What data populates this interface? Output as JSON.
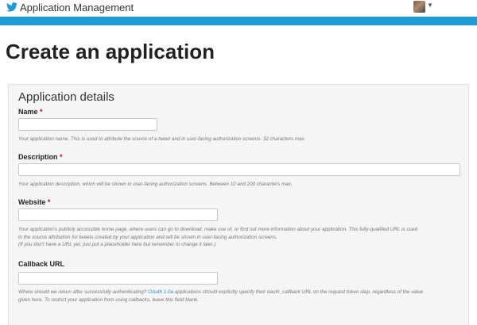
{
  "header": {
    "app_title": "Application Management",
    "logo_icon": "twitter-bird-icon",
    "brand_color": "#1f9ad6",
    "avatar_icon": "user-avatar",
    "menu_icon": "caret-down-icon"
  },
  "page": {
    "title": "Create an application"
  },
  "panel": {
    "title": "Application details",
    "fields": {
      "name": {
        "label": "Name",
        "required_mark": "*",
        "value": "",
        "help": "Your application name. This is used to attribute the source of a tweet and in user-facing authorization screens. 32 characters max."
      },
      "description": {
        "label": "Description",
        "required_mark": "*",
        "value": "",
        "help": "Your application description, which will be shown in user-facing authorization screens. Between 10 and 200 characters max."
      },
      "website": {
        "label": "Website",
        "required_mark": "*",
        "value": "",
        "help_line1": "Your application's publicly accessible home page, where users can go to download, make use of, or find out more information about your application. This fully-qualified URL is used",
        "help_line2": "in the source attribution for tweets created by your application and will be shown in user-facing authorization screens.",
        "help_line3": "(If you don't have a URL yet, just put a placeholder here but remember to change it later.)"
      },
      "callback": {
        "label": "Callback URL",
        "value": "",
        "help_before_link": "Where should we return after successfully authenticating? ",
        "help_link": "OAuth 1.0a",
        "help_after_link": " applications should explicitly specify their oauth_callback URL on the request token step, regardless of the value",
        "help_line2": "given here. To restrict your application from using callbacks, leave this field blank."
      }
    }
  }
}
